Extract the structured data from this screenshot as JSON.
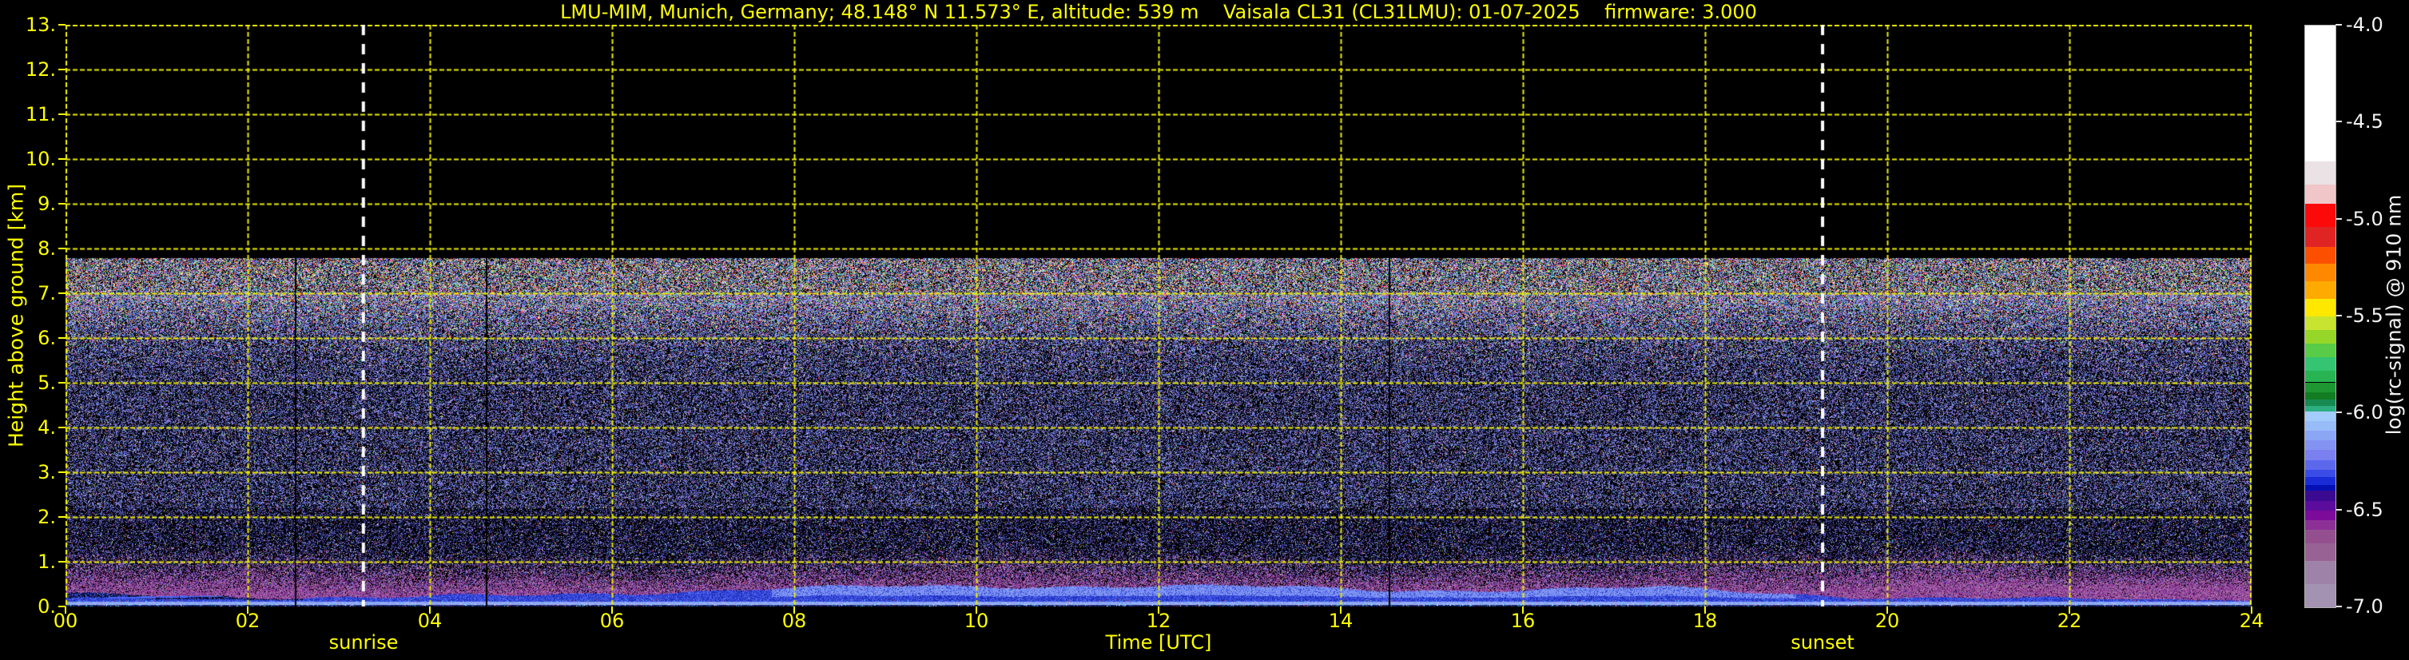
{
  "title": "LMU-MIM, Munich, Germany; 48.148° N 11.573° E, altitude: 539 m    Vaisala CL31 (CL31LMU): 01-07-2025    firmware: 3.000",
  "colors": {
    "background": "#000000",
    "axis_text": "#ffff00",
    "grid": "#ecec00",
    "colorbar_text": "#f2f2f2",
    "sun_line": "#ffffff"
  },
  "axes": {
    "x": {
      "label": "Time [UTC]",
      "ticks": [
        "00",
        "02",
        "04",
        "06",
        "08",
        "10",
        "12",
        "14",
        "16",
        "18",
        "20",
        "22",
        "24"
      ]
    },
    "y": {
      "label": "Height above ground [km]",
      "ticks": [
        "0.",
        "1.",
        "2.",
        "3.",
        "4.",
        "5.",
        "6.",
        "7.",
        "8.",
        "9.",
        "10.",
        "11.",
        "12.",
        "13."
      ]
    }
  },
  "annotations": {
    "sunrise": {
      "label": "sunrise",
      "hour_utc": 3.27
    },
    "sunset": {
      "label": "sunset",
      "hour_utc": 19.29
    }
  },
  "colorbar": {
    "label": "log(rc-signal) @ 910 nm",
    "ticks": [
      "-4.0",
      "-4.5",
      "-5.0",
      "-5.5",
      "-6.0",
      "-6.5",
      "-7.0"
    ],
    "range": [
      -4.0,
      -7.0
    ],
    "segments": [
      {
        "to": -4.7,
        "color": "#ffffff"
      },
      {
        "to": -4.82,
        "color": "#eae2e4"
      },
      {
        "to": -4.92,
        "color": "#f0c6c8"
      },
      {
        "to": -5.04,
        "color": "#fc0a0a"
      },
      {
        "to": -5.14,
        "color": "#e02424"
      },
      {
        "to": -5.23,
        "color": "#fc5000"
      },
      {
        "to": -5.32,
        "color": "#ff8800"
      },
      {
        "to": -5.41,
        "color": "#ffaa00"
      },
      {
        "to": -5.5,
        "color": "#ffe800"
      },
      {
        "to": -5.57,
        "color": "#c8e430"
      },
      {
        "to": -5.64,
        "color": "#96d628"
      },
      {
        "to": -5.71,
        "color": "#58cc46"
      },
      {
        "to": -5.78,
        "color": "#34c472"
      },
      {
        "to": -5.84,
        "color": "#28b452"
      },
      {
        "to": -5.89,
        "color": "#1e9632"
      },
      {
        "to": -5.93,
        "color": "#127c22"
      },
      {
        "to": -5.96,
        "color": "#168a50"
      },
      {
        "to": -5.99,
        "color": "#2cae80"
      },
      {
        "to": -6.04,
        "color": "#a4ccfa"
      },
      {
        "to": -6.09,
        "color": "#98bcf8"
      },
      {
        "to": -6.14,
        "color": "#8ca6f6"
      },
      {
        "to": -6.19,
        "color": "#8492f2"
      },
      {
        "to": -6.24,
        "color": "#7a80f0"
      },
      {
        "to": -6.29,
        "color": "#5c68ec"
      },
      {
        "to": -6.33,
        "color": "#3a4ce6"
      },
      {
        "to": -6.37,
        "color": "#1a2cd8"
      },
      {
        "to": -6.4,
        "color": "#0410b4"
      },
      {
        "to": -6.45,
        "color": "#3a0a90"
      },
      {
        "to": -6.5,
        "color": "#5c0c9c"
      },
      {
        "to": -6.55,
        "color": "#7c0a9a"
      },
      {
        "to": -6.6,
        "color": "#8c3096"
      },
      {
        "to": -6.67,
        "color": "#94508e"
      },
      {
        "to": -6.76,
        "color": "#986294"
      },
      {
        "to": -6.88,
        "color": "#9e82a8"
      },
      {
        "to": -7.0,
        "color": "#a392b2"
      }
    ]
  },
  "chart_data": {
    "type": "heatmap",
    "title": "LMU-MIM, Munich, Germany; 48.148° N 11.573° E, altitude: 539 m    Vaisala CL31 (CL31LMU): 01-07-2025    firmware: 3.000",
    "xlabel": "Time [UTC]",
    "ylabel": "Height above ground [km]",
    "x_range_hours": [
      0,
      24
    ],
    "x_tick_step_hours": 2,
    "y_range_km": [
      0,
      13
    ],
    "y_tick_step_km": 1,
    "value_label": "log(rc-signal) @ 910 nm",
    "value_range": [
      -4.0,
      -7.0
    ],
    "value_tick_step": 0.5,
    "legend_position": "right-colorbar",
    "grid": "yellow dashed at every 2 h and every 1 km",
    "annotations": [
      {
        "label": "sunrise",
        "hour_utc": 3.27,
        "style": "white dashed vertical line"
      },
      {
        "label": "sunset",
        "hour_utc": 19.29,
        "style": "white dashed vertical line"
      }
    ],
    "observed_features": {
      "noise_ceiling_km": 7.78,
      "description_above_ceiling": "pure black (no data) from 7.8 km to 13 km",
      "free_atmosphere_noise_km": [
        1.4,
        7.78
      ],
      "noise_character": "random speckle; mostly dark blue/lavender on black at mid levels, dense multicolor confetti (white/red/yellow/green/cyan) near 6.5-7.8 km",
      "residual_layer_purple_band_km": [
        0.2,
        1.3
      ],
      "mixed_layer_blue_band_top_km": {
        "night": 0.2,
        "morning_rise_hours": [
          4,
          9
        ],
        "midday": 0.46,
        "evening": 0.16
      },
      "strong_near_surface_signal_km": [
        0.0,
        0.15
      ],
      "data_gap_hours": [
        2.52,
        4.61,
        14.53
      ]
    }
  }
}
